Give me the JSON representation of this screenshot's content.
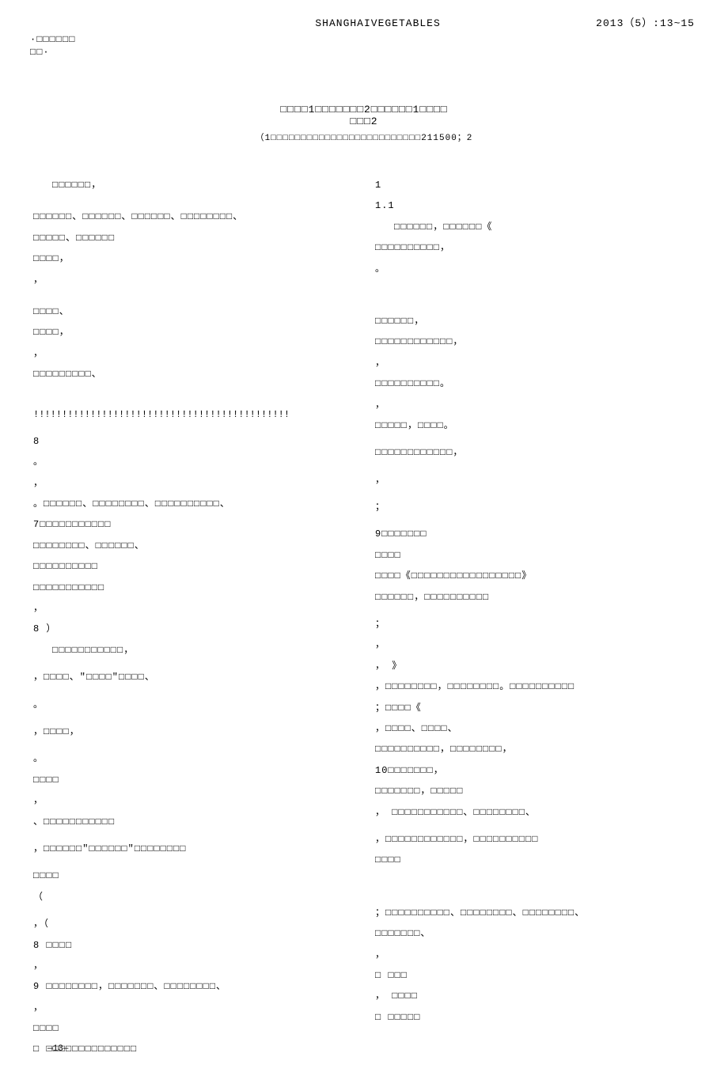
{
  "header": {
    "journal": "SHANGHAIVEGETABLES",
    "citation": "2013（5）:13~15"
  },
  "section_tag_top": "·□□□□□□",
  "section_tag_sub": " □□·",
  "authors_line": "□□□□1□□□□□□□2□□□□□□1□□□□",
  "authors_sub": "□□□2",
  "affiliation": "（1□□□□□□□□□□□□□□□□□□□□□□□□□211500；2",
  "left": {
    "l1": "□□□□□□，",
    "l2": "□□□□□□、□□□□□□、□□□□□□、□□□□□□□□、",
    "l3": "□□□□□、□□□□□□",
    "l4": "□□□□，",
    "l5": "，",
    "l6": "□□□□、",
    "l7": "□□□□，",
    "l8": "，",
    "l9": "□□□□□□□□□、",
    "exclaim": "!!!!!!!!!!!!!!!!!!!!!!!!!!!!!!!!!!!!!!!!!!!!!",
    "l10": "8",
    "l11": "。",
    "l12": "，",
    "l13": "。□□□□□□、□□□□□□□□、□□□□□□□□□□、",
    "l14": "7□□□□□□□□□□□",
    "l15": "□□□□□□□□、□□□□□□、",
    "l16": "□□□□□□□□□□",
    "l17": "□□□□□□□□□□□",
    "l18": "，",
    "l19": "8                    ）",
    "l20": "□□□□□□□□□□□，",
    "l21": "，□□□□、\"□□□□\"□□□□、",
    "l22": "。",
    "l23": "，□□□□，",
    "l24": "。",
    "l25": "□□□□",
    "l26": "，",
    "l27": "、□□□□□□□□□□□",
    "l28": "，□□□□□□\"□□□□□□\"□□□□□□□□",
    "l29": "□□□□",
    "l30": "（",
    "l31": "，（",
    "l32": "8 □□□□",
    "l33": "，",
    "l34": "9 □□□□□□□□，□□□□□□□、□□□□□□□□、",
    "l35": "，",
    "l36": "  □□□□",
    "l37": "□ □□□□□□□□□□□□□□"
  },
  "right": {
    "r1": "1",
    "r2": "1.1",
    "r3": "□□□□□□，□□□□□□《",
    "r4": "□□□□□□□□□□，",
    "r5": "。",
    "r6": "□□□□□□，",
    "r7": "□□□□□□□□□□□□，",
    "r8": "，",
    "r9": "□□□□□□□□□□。",
    "r10": "，",
    "r11": "□□□□□，□□□□。",
    "r12": "□□□□□□□□□□□□，",
    "r13": "，",
    "r14": "；",
    "r15": "9□□□□□□□",
    "r16": "□□□□",
    "r17": "    □□□□《□□□□□□□□□□□□□□□□□》",
    "r18": "   □□□□□□，□□□□□□□□□□",
    "r19": "；",
    "r20": "，",
    "r21": "，   》",
    "r22": "，□□□□□□□□，□□□□□□□□。□□□□□□□□□□",
    "r23": "；□□□□《",
    "r24": "，□□□□、□□□□、",
    "r25": "□□□□□□□□□□，□□□□□□□□，",
    "r26": "10□□□□□□□，",
    "r27": "□□□□□□□，□□□□□",
    "r28": "，   □□□□□□□□□□□、□□□□□□□□、",
    "r29": "，□□□□□□□□□□□□，□□□□□□□□□□",
    "r30": "□□□□",
    "r31": "；□□□□□□□□□□、□□□□□□□□、□□□□□□□□、",
    "r32": "  □□□□□□□、",
    "r33": "，",
    "r34": "□ □□□",
    "r35": "，   □□□□",
    "r36": "□ □□□□□"
  },
  "page_num": "—13—"
}
